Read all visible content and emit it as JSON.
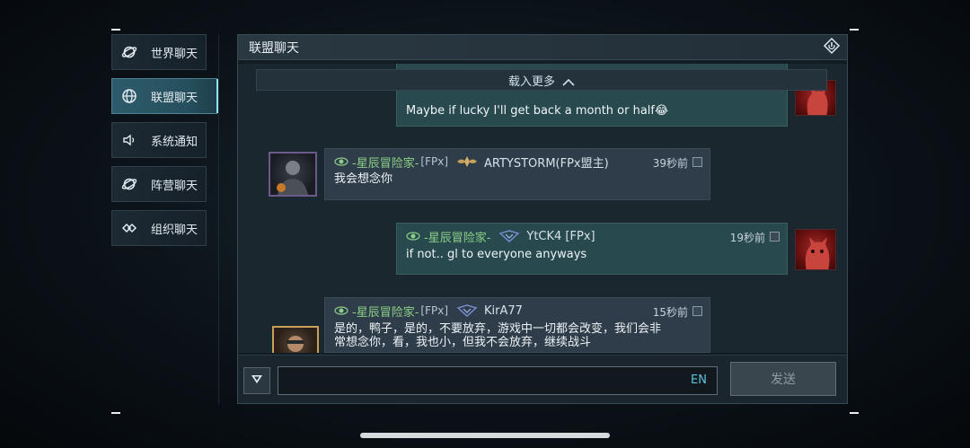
{
  "sidebar": {
    "items": [
      {
        "label": "世界聊天",
        "icon": "planet-icon",
        "active": false
      },
      {
        "label": "联盟聊天",
        "icon": "globe-icon",
        "active": true
      },
      {
        "label": "系统通知",
        "icon": "speaker-icon",
        "active": false
      },
      {
        "label": "阵营聊天",
        "icon": "planet-icon",
        "active": false
      },
      {
        "label": "组织聊天",
        "icon": "link-icon",
        "active": false
      }
    ]
  },
  "panel": {
    "title": "联盟聊天",
    "load_more": "载入更多"
  },
  "messages": [
    {
      "text": "Maybe if lucky I'll get back a month or half😂",
      "self": true
    },
    {
      "guild": "-星辰冒险家-",
      "tag": "[FPx]",
      "name": "ARTYSTORM(FPx盟主)",
      "time": "39秒前",
      "text": "我会想念你",
      "self": false
    },
    {
      "guild": "-星辰冒险家-",
      "tag": "",
      "name": "YtCK4 [FPx]",
      "time": "19秒前",
      "text": "if not.. gl to everyone anyways",
      "self": true
    },
    {
      "guild": "-星辰冒险家-",
      "tag": "[FPx]",
      "name": "KirA77",
      "time": "15秒前",
      "text_line1": "是的，鸭子，是的，不要放弃，游戏中一切都会改变，我们会非",
      "text_line2": "常想念你，看，我也小，但我不会放弃，继续战斗",
      "self": false
    }
  ],
  "input": {
    "value": "",
    "lang": "EN",
    "send_label": "发送"
  },
  "colors": {
    "accent": "#8fe1f0",
    "guild_green": "#8ccf86",
    "lang_blue": "#5ec3dc"
  }
}
